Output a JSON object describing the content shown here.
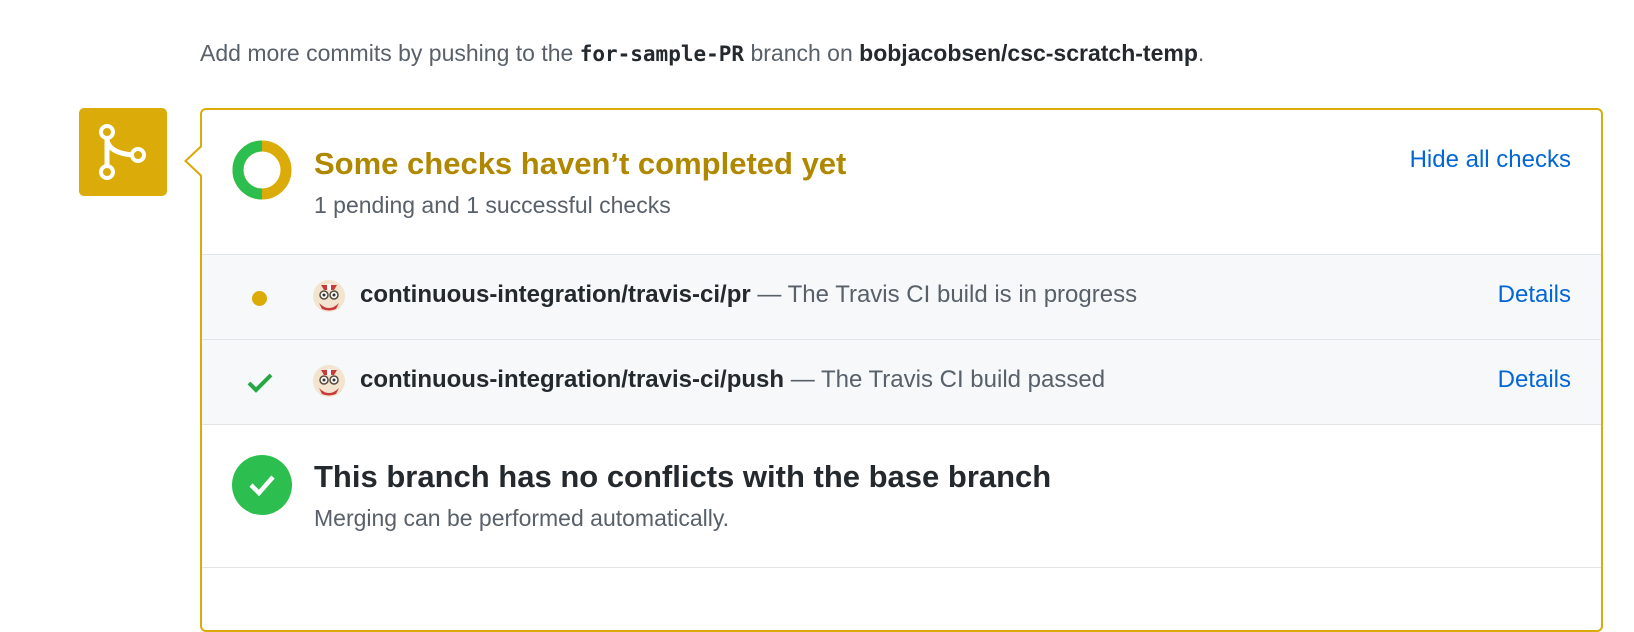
{
  "intro": {
    "prefix": "Add more commits by pushing to the",
    "branch": "for-sample-PR",
    "middle": "branch on",
    "repo": "bobjacobsen/csc-scratch-temp",
    "suffix": "."
  },
  "status": {
    "title": "Some checks haven’t completed yet",
    "summary": "1 pending and 1 successful checks",
    "toggle_label": "Hide all checks",
    "pending_count": 1,
    "success_count": 1
  },
  "checks": [
    {
      "state": "pending",
      "context": "continuous-integration/travis-ci/pr",
      "separator": " — ",
      "description": "The Travis CI build is in progress",
      "details_label": "Details"
    },
    {
      "state": "success",
      "context": "continuous-integration/travis-ci/push",
      "separator": " — ",
      "description": "The Travis CI build passed",
      "details_label": "Details"
    }
  ],
  "merge": {
    "title": "This branch has no conflicts with the base branch",
    "subtitle": "Merging can be performed automatically."
  },
  "colors": {
    "pending": "#dbab09",
    "pending_text": "#b08800",
    "success": "#2cbe4e",
    "link": "#0366d6"
  },
  "icons": {
    "merge_badge": "git-branch-icon",
    "status": "status-donut-icon",
    "pending": "pending-dot-icon",
    "success": "check-icon",
    "avatar": "travis-ci-avatar-icon",
    "merge_ok": "check-circle-icon"
  }
}
